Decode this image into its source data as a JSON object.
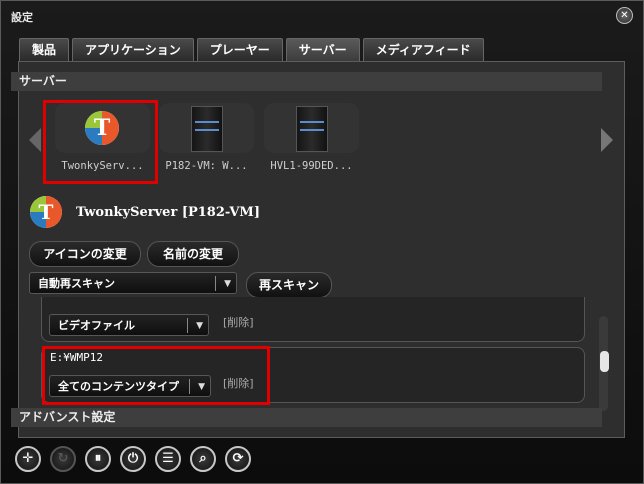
{
  "window": {
    "title": "設定"
  },
  "tabs": [
    "製品",
    "アプリケーション",
    "プレーヤー",
    "サーバー",
    "メディアフィード"
  ],
  "server_section": {
    "title": "サーバー"
  },
  "servers": [
    {
      "label": "TwonkyServ...",
      "icon": "twonky-logo"
    },
    {
      "label": "P182-VM: W...",
      "icon": "server-tower"
    },
    {
      "label": "HVL1-99DED...",
      "icon": "server-tower"
    }
  ],
  "selected_server": {
    "name": "TwonkyServer [P182-VM]"
  },
  "buttons": {
    "change_icon": "アイコンの変更",
    "change_name": "名前の変更",
    "rescan": "再スキャン"
  },
  "scan_mode": {
    "value": "自動再スキャン"
  },
  "folders": [
    {
      "path": "",
      "content_type": "ビデオファイル",
      "delete_label": "[削除]"
    },
    {
      "path": "E:¥WMP12",
      "content_type": "全てのコンテンツタイプ",
      "delete_label": "[削除]"
    }
  ],
  "advanced_section": {
    "title": "アドバンスト設定"
  },
  "toolbar": [
    "add-icon",
    "refresh-icon",
    "pause-icon",
    "power-icon",
    "list-icon",
    "search-icon",
    "sync-icon"
  ],
  "scrollbar": {
    "position": 0.5
  },
  "colors": {
    "highlight": "#e00000",
    "background": "#2e2e2e"
  }
}
